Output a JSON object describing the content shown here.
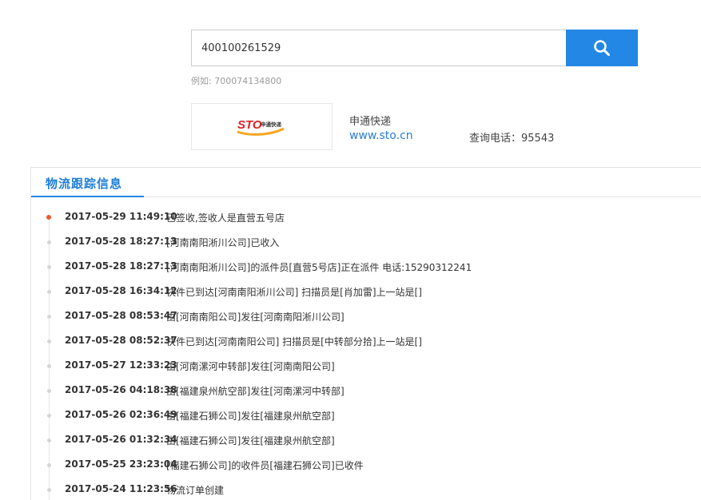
{
  "search": {
    "value": "400100261529",
    "example_label": "例如:",
    "example_number": "700074134800"
  },
  "carrier": {
    "logo_text": "STO",
    "logo_subtext": "申通快递",
    "name": "申通快递",
    "website": "www.sto.cn",
    "phone_label": "查询电话：",
    "phone": "95543"
  },
  "tracking": {
    "tab_label": "物流跟踪信息",
    "events": [
      {
        "time": "2017-05-29 11:49:10",
        "desc": "已签收,签收人是直营五号店",
        "active": true
      },
      {
        "time": "2017-05-28 18:27:13",
        "desc": "[河南南阳淅川公司]已收入",
        "active": false
      },
      {
        "time": "2017-05-28 18:27:13",
        "desc": "[河南南阳淅川公司]的派件员[直营5号店]正在派件 电话:15290312241",
        "active": false
      },
      {
        "time": "2017-05-28 16:34:12",
        "desc": "快件已到达[河南南阳淅川公司] 扫描员是[肖加雷]上一站是[]",
        "active": false
      },
      {
        "time": "2017-05-28 08:53:47",
        "desc": "由[河南南阳公司]发往[河南南阳淅川公司]",
        "active": false
      },
      {
        "time": "2017-05-28 08:52:37",
        "desc": "快件已到达[河南南阳公司] 扫描员是[中转部分拾]上一站是[]",
        "active": false
      },
      {
        "time": "2017-05-27 12:33:23",
        "desc": "由[河南漯河中转部]发往[河南南阳公司]",
        "active": false
      },
      {
        "time": "2017-05-26 04:18:38",
        "desc": "由[福建泉州航空部]发往[河南漯河中转部]",
        "active": false
      },
      {
        "time": "2017-05-26 02:36:49",
        "desc": "由[福建石狮公司]发往[福建泉州航空部]",
        "active": false
      },
      {
        "time": "2017-05-26 01:32:34",
        "desc": "由[福建石狮公司]发往[福建泉州航空部]",
        "active": false
      },
      {
        "time": "2017-05-25 23:23:04",
        "desc": "[福建石狮公司]的收件员[福建石狮公司]已收件",
        "active": false
      },
      {
        "time": "2017-05-24 11:23:56",
        "desc": "物流订单创建",
        "active": false
      }
    ]
  },
  "colors": {
    "accent": "#2388e5",
    "active_dot": "#f05a2a",
    "link": "#2a7ed6"
  },
  "icons": {
    "search": "search-icon"
  }
}
